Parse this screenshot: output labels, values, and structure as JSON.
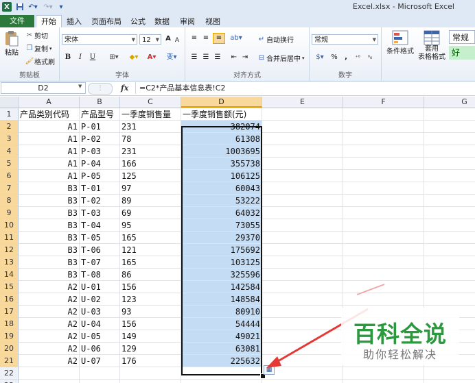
{
  "window": {
    "title": "Excel.xlsx - Microsoft Excel",
    "logo": "X"
  },
  "quick_access": {
    "save_icon": "save-icon",
    "undo_icon": "undo-icon",
    "redo_icon": "redo-icon"
  },
  "tabs": [
    {
      "label": "文件"
    },
    {
      "label": "开始"
    },
    {
      "label": "插入"
    },
    {
      "label": "页面布局"
    },
    {
      "label": "公式"
    },
    {
      "label": "数据"
    },
    {
      "label": "审阅"
    },
    {
      "label": "视图"
    }
  ],
  "ribbon": {
    "clipboard": {
      "paste": "粘贴",
      "cut": "剪切",
      "copy": "复制",
      "format_painter": "格式刷",
      "label": "剪贴板"
    },
    "font": {
      "name": "宋体",
      "size": "12",
      "bold": "B",
      "italic": "I",
      "underline": "U",
      "grow": "A",
      "shrink": "A",
      "wen": "变",
      "label": "字体"
    },
    "alignment": {
      "wrap_text": "自动换行",
      "merge_center": "合并后居中",
      "label": "对齐方式"
    },
    "number": {
      "format": "常规",
      "percent": "%",
      "comma": ",",
      "label": "数字"
    },
    "styles": {
      "conditional_format": "条件格式",
      "table_format_line1": "套用",
      "table_format_line2": "表格格式",
      "style_normal": "常规",
      "style_good": "好"
    }
  },
  "formula_bar": {
    "name_box": "D2",
    "fx": "fx",
    "formula": "=C2*产品基本信息表!C2"
  },
  "columns": [
    "A",
    "B",
    "C",
    "D",
    "E",
    "F",
    "G"
  ],
  "selected_column": "D",
  "rows": [
    {
      "n": "1",
      "a": "产品类别代码",
      "b": "产品型号",
      "c": "一季度销售量",
      "d": "一季度销售额(元)"
    },
    {
      "n": "2",
      "a": "A1",
      "b": "P-01",
      "c": "231",
      "d": "382074"
    },
    {
      "n": "3",
      "a": "A1",
      "b": "P-02",
      "c": "78",
      "d": "61308"
    },
    {
      "n": "4",
      "a": "A1",
      "b": "P-03",
      "c": "231",
      "d": "1003695"
    },
    {
      "n": "5",
      "a": "A1",
      "b": "P-04",
      "c": "166",
      "d": "355738"
    },
    {
      "n": "6",
      "a": "A1",
      "b": "P-05",
      "c": "125",
      "d": "106125"
    },
    {
      "n": "7",
      "a": "B3",
      "b": "T-01",
      "c": "97",
      "d": "60043"
    },
    {
      "n": "8",
      "a": "B3",
      "b": "T-02",
      "c": "89",
      "d": "53222"
    },
    {
      "n": "9",
      "a": "B3",
      "b": "T-03",
      "c": "69",
      "d": "64032"
    },
    {
      "n": "10",
      "a": "B3",
      "b": "T-04",
      "c": "95",
      "d": "73055"
    },
    {
      "n": "11",
      "a": "B3",
      "b": "T-05",
      "c": "165",
      "d": "29370"
    },
    {
      "n": "12",
      "a": "B3",
      "b": "T-06",
      "c": "121",
      "d": "175692"
    },
    {
      "n": "13",
      "a": "B3",
      "b": "T-07",
      "c": "165",
      "d": "103125"
    },
    {
      "n": "14",
      "a": "B3",
      "b": "T-08",
      "c": "86",
      "d": "325596"
    },
    {
      "n": "15",
      "a": "A2",
      "b": "U-01",
      "c": "156",
      "d": "142584"
    },
    {
      "n": "16",
      "a": "A2",
      "b": "U-02",
      "c": "123",
      "d": "148584"
    },
    {
      "n": "17",
      "a": "A2",
      "b": "U-03",
      "c": "93",
      "d": "80910"
    },
    {
      "n": "18",
      "a": "A2",
      "b": "U-04",
      "c": "156",
      "d": "54444"
    },
    {
      "n": "19",
      "a": "A2",
      "b": "U-05",
      "c": "149",
      "d": "49021"
    },
    {
      "n": "20",
      "a": "A2",
      "b": "U-06",
      "c": "129",
      "d": "63081"
    },
    {
      "n": "21",
      "a": "A2",
      "b": "U-07",
      "c": "176",
      "d": "225632"
    },
    {
      "n": "22",
      "a": "",
      "b": "",
      "c": "",
      "d": ""
    },
    {
      "n": "23",
      "a": "",
      "b": "",
      "c": "",
      "d": ""
    }
  ],
  "watermark": {
    "title": "百科全说",
    "subtitle": "助你轻松解决"
  },
  "colors": {
    "selection_fill": "#c5dcf5",
    "header_highlight": "#f9d99b",
    "arrow": "#e53935",
    "watermark_green": "#2b9a3e"
  }
}
